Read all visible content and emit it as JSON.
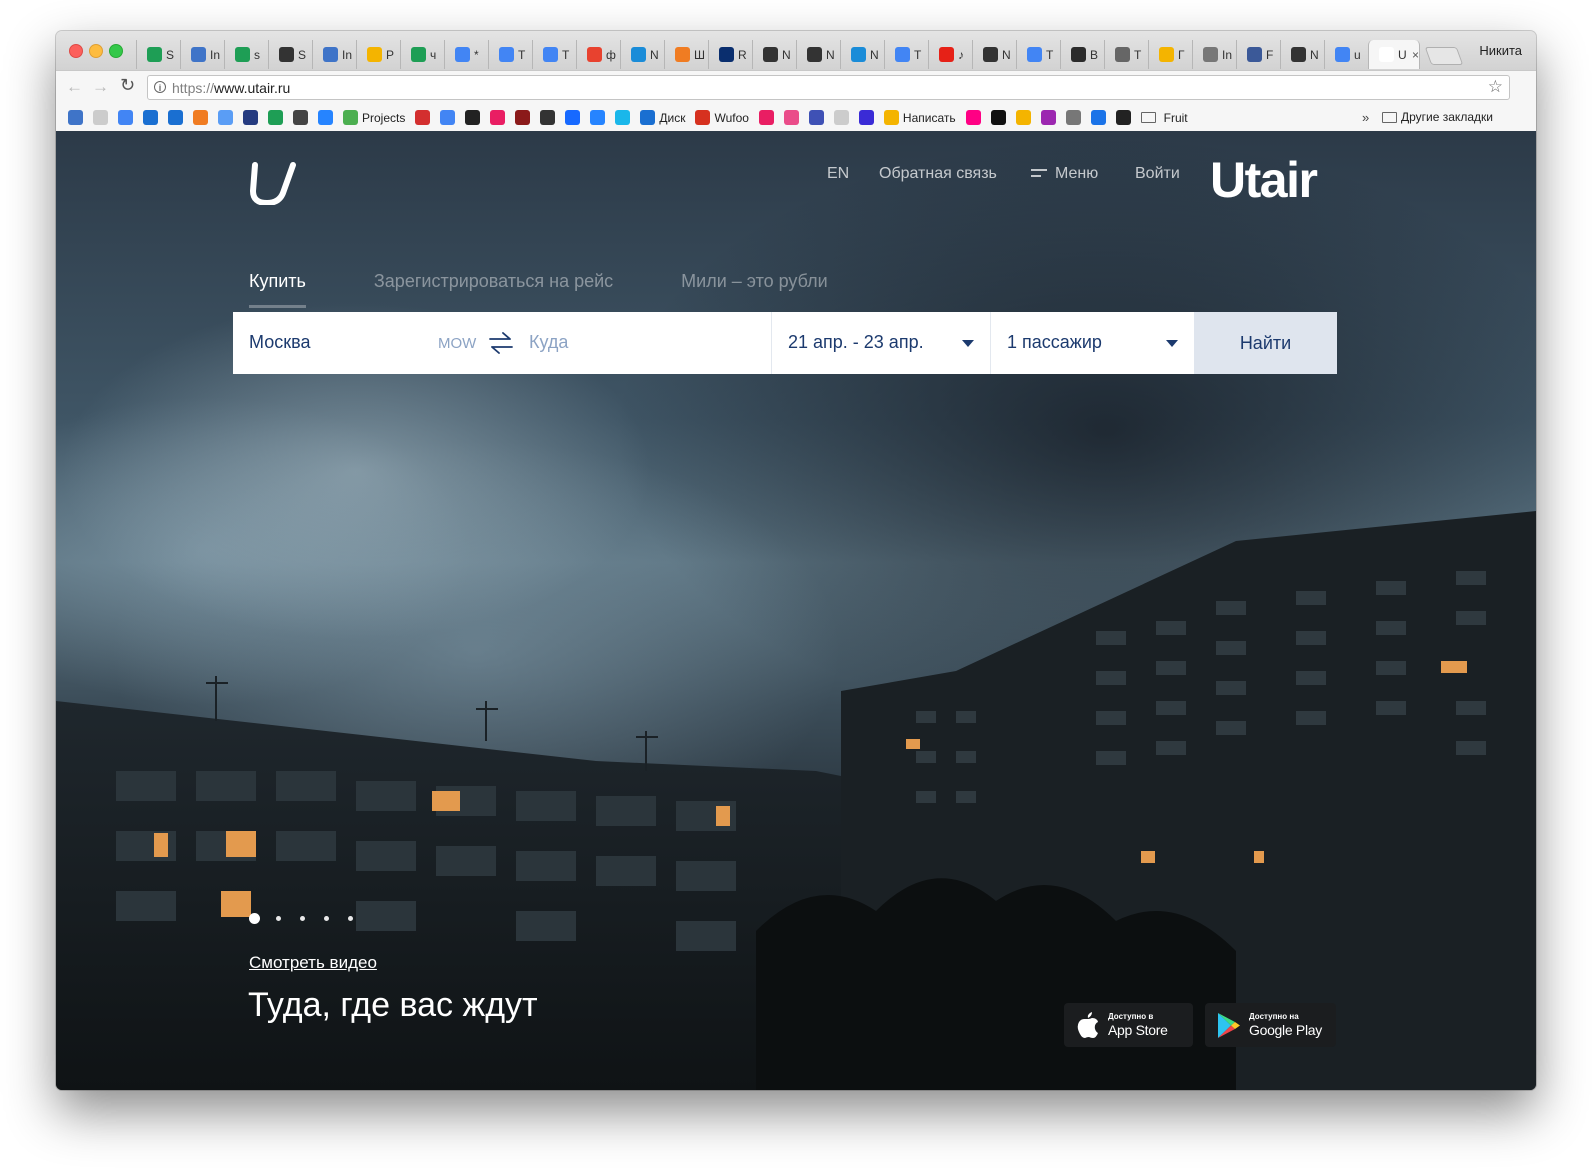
{
  "browser": {
    "tabs": [
      {
        "label": "S",
        "color": "#1e9e55"
      },
      {
        "label": "In",
        "color": "#3f74c8"
      },
      {
        "label": "s",
        "color": "#1e9e55"
      },
      {
        "label": "S",
        "color": "#333333"
      },
      {
        "label": "In",
        "color": "#3f74c8"
      },
      {
        "label": "P",
        "color": "#f4b400"
      },
      {
        "label": "ч",
        "color": "#1e9e55"
      },
      {
        "label": "*",
        "color": "#4285f4"
      },
      {
        "label": "T",
        "color": "#4285f4"
      },
      {
        "label": "T",
        "color": "#4285f4"
      },
      {
        "label": "ф",
        "color": "#e8422f"
      },
      {
        "label": "N",
        "color": "#1a8cd8"
      },
      {
        "label": "Ш",
        "color": "#f07c22"
      },
      {
        "label": "R",
        "color": "#0a2e6e"
      },
      {
        "label": "N",
        "color": "#333333"
      },
      {
        "label": "N",
        "color": "#333333"
      },
      {
        "label": "N",
        "color": "#1a8cd8"
      },
      {
        "label": "T",
        "color": "#4285f4"
      },
      {
        "label": "♪",
        "color": "#e62117"
      },
      {
        "label": "N",
        "color": "#333333"
      },
      {
        "label": "T",
        "color": "#4285f4"
      },
      {
        "label": "B",
        "color": "#2b2b2b"
      },
      {
        "label": "T",
        "color": "#666666"
      },
      {
        "label": "Г",
        "color": "#f4b400"
      },
      {
        "label": "In",
        "color": "#777777"
      },
      {
        "label": "F",
        "color": "#3b5998"
      },
      {
        "label": "N",
        "color": "#333333"
      },
      {
        "label": "u",
        "color": "#4285f4"
      }
    ],
    "active_tab": {
      "label": "U",
      "color": "#ffffff"
    },
    "profile_name": "Никита",
    "url_scheme": "https://",
    "url_host": "www.utair.ru",
    "bookmarks": [
      {
        "label": "",
        "color": "#3f74c8"
      },
      {
        "label": "",
        "color": "#cccccc"
      },
      {
        "label": "",
        "color": "#4285f4"
      },
      {
        "label": "",
        "color": "#1a6fd1"
      },
      {
        "label": "",
        "color": "#1a6fd1"
      },
      {
        "label": "",
        "color": "#f07c22"
      },
      {
        "label": "",
        "color": "#5a9df5"
      },
      {
        "label": "",
        "color": "#253b80"
      },
      {
        "label": "",
        "color": "#1e9e55"
      },
      {
        "label": "",
        "color": "#444444"
      },
      {
        "label": "",
        "color": "#2684ff"
      },
      {
        "label": "Projects",
        "color": "#4caf50"
      },
      {
        "label": "",
        "color": "#d32f2f"
      },
      {
        "label": "",
        "color": "#4285f4"
      },
      {
        "label": "",
        "color": "#222222"
      },
      {
        "label": "",
        "color": "#e91e63"
      },
      {
        "label": "",
        "color": "#8b1a1a"
      },
      {
        "label": "",
        "color": "#333333"
      },
      {
        "label": "",
        "color": "#1769ff"
      },
      {
        "label": "",
        "color": "#2684ff"
      },
      {
        "label": "",
        "color": "#1ab7ea"
      },
      {
        "label": "Диск",
        "color": "#1a6fd1"
      },
      {
        "label": "Wufoo",
        "color": "#d6311f"
      },
      {
        "label": "",
        "color": "#e91e63"
      },
      {
        "label": "",
        "color": "#ea4c89"
      },
      {
        "label": "",
        "color": "#3f51b5"
      },
      {
        "label": "",
        "color": "#cccccc"
      },
      {
        "label": "",
        "color": "#3a2bd6"
      },
      {
        "label": "Написать",
        "color": "#f4b400"
      },
      {
        "label": "",
        "color": "#ff0084"
      },
      {
        "label": "",
        "color": "#111111"
      },
      {
        "label": "",
        "color": "#f4b400"
      },
      {
        "label": "",
        "color": "#9c27b0"
      },
      {
        "label": "",
        "color": "#777777"
      },
      {
        "label": "",
        "color": "#1a73e8"
      },
      {
        "label": "",
        "color": "#222222"
      }
    ],
    "bookmarks_more": "»",
    "bookmarks_folder_fruit": "Fruit",
    "bookmarks_folder_other": "Другие закладки"
  },
  "site": {
    "brand": "Utair",
    "nav": {
      "lang": "EN",
      "feedback": "Обратная связь",
      "menu": "Меню",
      "login": "Войти"
    },
    "search_tabs": [
      "Купить",
      "Зарегистрироваться на рейс",
      "Мили – это рубли"
    ],
    "form": {
      "from_value": "Москва",
      "from_code": "MOW",
      "to_placeholder": "Куда",
      "dates_value": "21 апр. - 23 апр.",
      "passengers_value": "1 пассажир",
      "find_label": "Найти"
    },
    "slider_count": 5,
    "slider_active": 1,
    "video_link": "Смотреть видео",
    "tagline": "Туда, где вас ждут",
    "app_store": {
      "small": "Доступно в",
      "big": "App Store"
    },
    "google_play": {
      "small": "Доступно на",
      "big": "Google Play"
    },
    "colors": {
      "accent": "#1c3a6e",
      "muted": "#8ca3c4",
      "find_bg": "#dfe5ee"
    }
  }
}
